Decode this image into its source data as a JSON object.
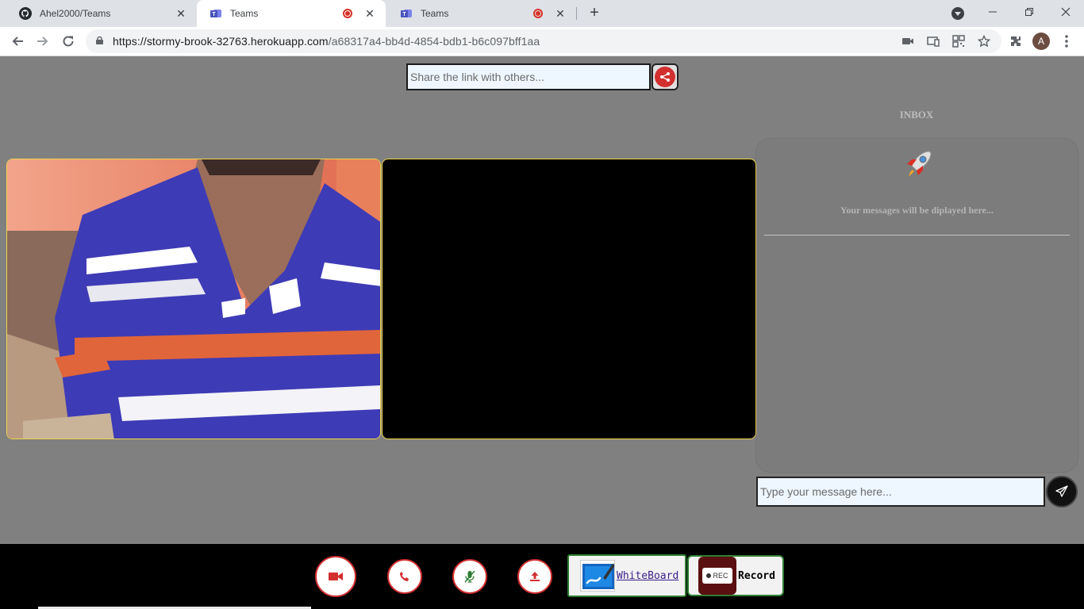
{
  "browser": {
    "tabs": [
      {
        "label": "Ahel2000/Teams",
        "icon": "github-icon",
        "recording": false,
        "active": false
      },
      {
        "label": "Teams",
        "icon": "teams-icon",
        "recording": true,
        "active": true
      },
      {
        "label": "Teams",
        "icon": "teams-icon",
        "recording": true,
        "active": false
      }
    ],
    "url_host": "https://stormy-brook-32763.herokuapp.com",
    "url_path": "/a68317a4-bb4d-4854-bdb1-b6c097bff1aa",
    "profile_initial": "A"
  },
  "share": {
    "placeholder": "Share the link with others..."
  },
  "inbox": {
    "title": "INBOX",
    "empty_text": "Your messages will be diplayed here...",
    "message_placeholder": "Type your message here..."
  },
  "controls": {
    "whiteboard_label": "WhiteBoard",
    "record_label": "Record",
    "rec_badge": "REC"
  },
  "colors": {
    "page_bg": "#808080",
    "accent_red": "#d32f2f",
    "video_border": "#f0d54a",
    "control_border": "#2e7d32"
  }
}
